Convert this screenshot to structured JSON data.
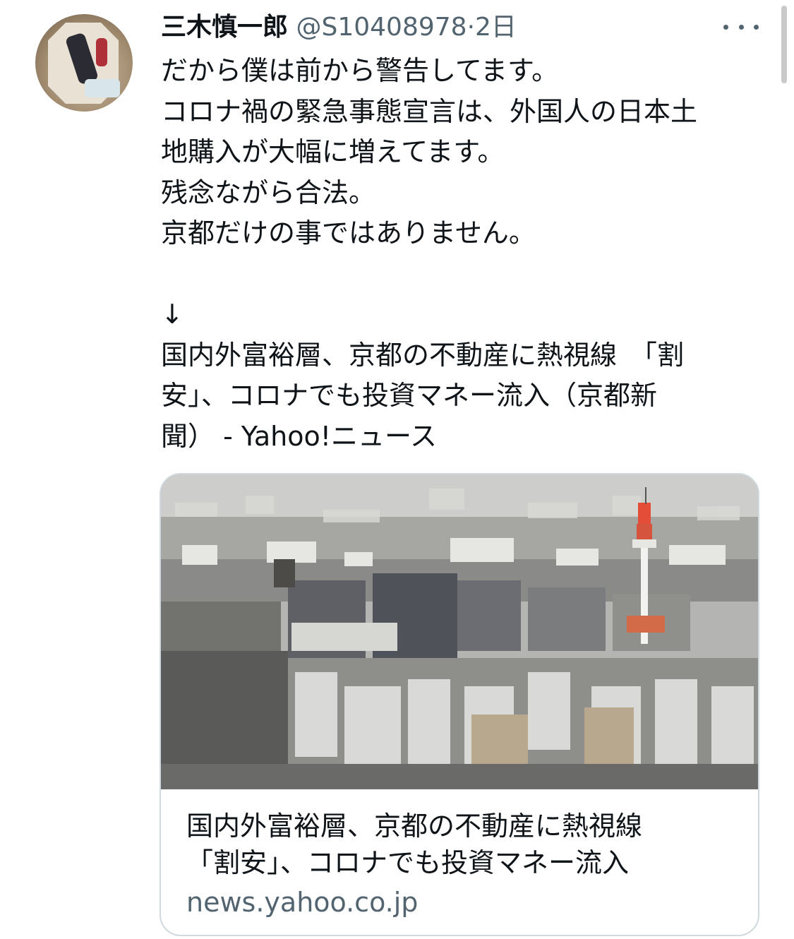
{
  "tweet": {
    "author_name": "三木慎一郎",
    "author_handle": "@S10408978",
    "separator": "·",
    "time": "2日",
    "text_lines": [
      "だから僕は前から警告してます。",
      "コロナ禍の緊急事態宣言は、外国人の日本土",
      "地購入が大幅に増えてます。",
      "残念ながら合法。",
      "京都だけの事ではありません。",
      "",
      "↓",
      "国内外富裕層、京都の不動産に熱視線　「割",
      "安」、コロナでも投資マネー流入（京都新",
      "聞） - Yahoo!ニュース"
    ]
  },
  "card": {
    "title_lines": [
      "国内外富裕層、京都の不動産に熱視線",
      "「割安」、コロナでも投資マネー流入"
    ],
    "domain": "news.yahoo.co.jp"
  },
  "icons": {
    "more": "more-horizontal-icon",
    "avatar": "avatar"
  }
}
